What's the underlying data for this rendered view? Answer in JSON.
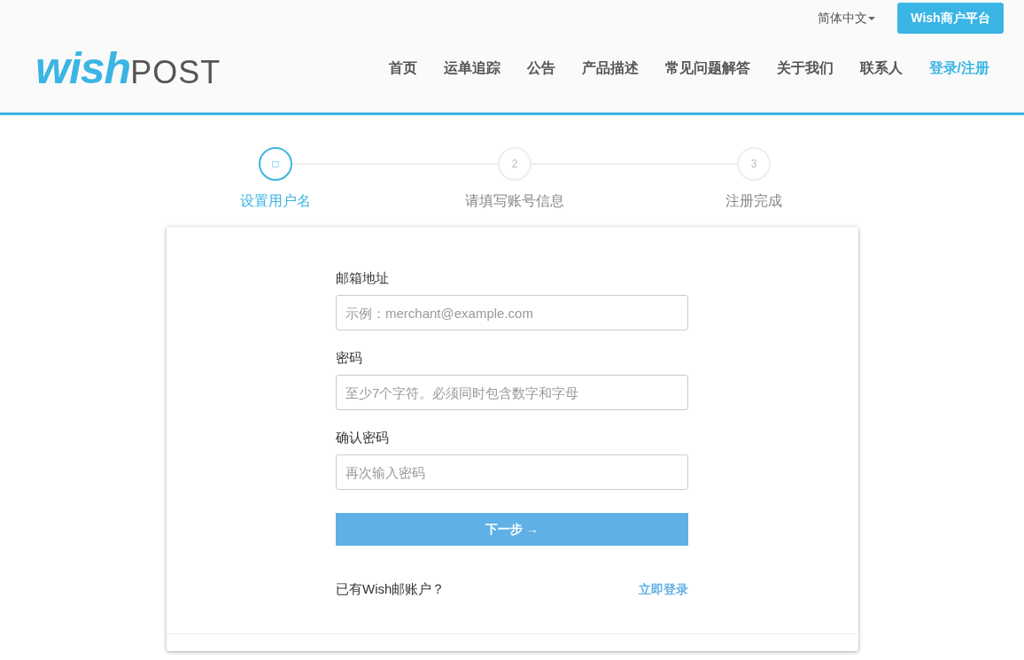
{
  "header": {
    "language": "简体中文",
    "merchant_button": "Wish商户平台",
    "logo": {
      "brand": "wish",
      "suffix": "POST"
    },
    "nav": [
      {
        "label": "首页",
        "selected": false
      },
      {
        "label": "运单追踪",
        "selected": false
      },
      {
        "label": "公告",
        "selected": false
      },
      {
        "label": "产品描述",
        "selected": false
      },
      {
        "label": "常见问题解答",
        "selected": false
      },
      {
        "label": "关于我们",
        "selected": false
      },
      {
        "label": "联系人",
        "selected": false
      },
      {
        "label": "登录/注册",
        "selected": true
      }
    ]
  },
  "steps": [
    {
      "marker": "□",
      "label": "设置用户名",
      "selected": true
    },
    {
      "marker": "2",
      "label": "请填写账号信息",
      "selected": false
    },
    {
      "marker": "3",
      "label": "注册完成",
      "selected": false
    }
  ],
  "form": {
    "fields": [
      {
        "label": "邮箱地址",
        "placeholder": "示例：merchant@example.com"
      },
      {
        "label": "密码",
        "placeholder": "至少7个字符。必须同时包含数字和字母"
      },
      {
        "label": "确认密码",
        "placeholder": "再次输入密码"
      }
    ],
    "submit": "下一步 →",
    "login_prompt": "已有Wish邮账户？",
    "login_link": "立即登录"
  }
}
